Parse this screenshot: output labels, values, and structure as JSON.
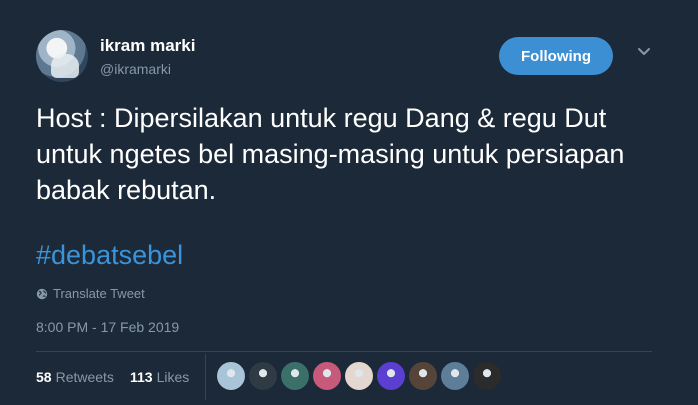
{
  "user": {
    "display_name": "ikram marki",
    "handle": "@ikramarki"
  },
  "actions": {
    "follow_label": "Following"
  },
  "tweet": {
    "text": "Host : Dipersilakan untuk regu Dang & regu Dut untuk ngetes bel masing-masing untuk persiapan babak rebutan.",
    "hashtag": "#debatsebel",
    "translate_label": "Translate Tweet",
    "timestamp": "8:00 PM - 17 Feb 2019"
  },
  "stats": {
    "retweets_count": "58",
    "retweets_label": "Retweets",
    "likes_count": "113",
    "likes_label": "Likes"
  },
  "icons": {
    "dropdown": "chevron-down-icon",
    "translate": "globe-icon"
  },
  "colors": {
    "background": "#1c2938",
    "accent": "#3b94d9",
    "follow_button": "#3c8fd3",
    "muted_text": "#8899a6",
    "divider": "#38444d"
  },
  "likers": [
    {
      "color": "#a9c4d6"
    },
    {
      "color": "#2e3a44"
    },
    {
      "color": "#3a6f6a"
    },
    {
      "color": "#c75a7a"
    },
    {
      "color": "#e3d7d0"
    },
    {
      "color": "#5a3fd0"
    },
    {
      "color": "#574438"
    },
    {
      "color": "#5e7d99"
    },
    {
      "color": "#2b2b2b"
    }
  ]
}
